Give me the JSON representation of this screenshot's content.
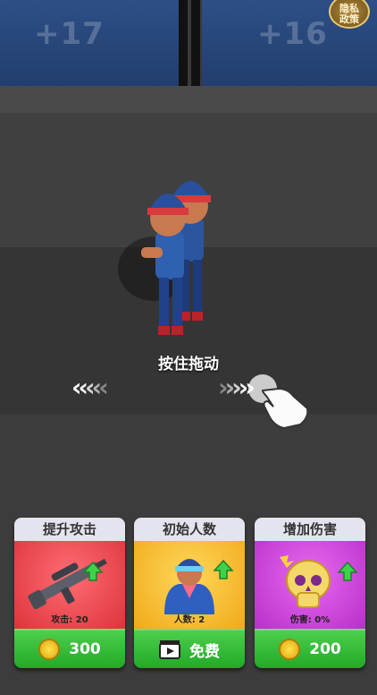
{
  "gates": {
    "left_value": "+17",
    "right_value": "+16"
  },
  "badge": {
    "line1": "隐私",
    "line2": "政策"
  },
  "tutorial": {
    "hint": "按住拖动"
  },
  "cards": [
    {
      "title": "提升攻击",
      "stat": "攻击: 20",
      "button": "300",
      "button_icon": "coin-icon",
      "color": "#e8424a"
    },
    {
      "title": "初始人数",
      "stat": "人数: 2",
      "button": "免费",
      "button_icon": "video-icon",
      "color": "#f2b623"
    },
    {
      "title": "增加伤害",
      "stat": "伤害: 0%",
      "button": "200",
      "button_icon": "coin-icon",
      "color": "#c33ad4"
    }
  ]
}
